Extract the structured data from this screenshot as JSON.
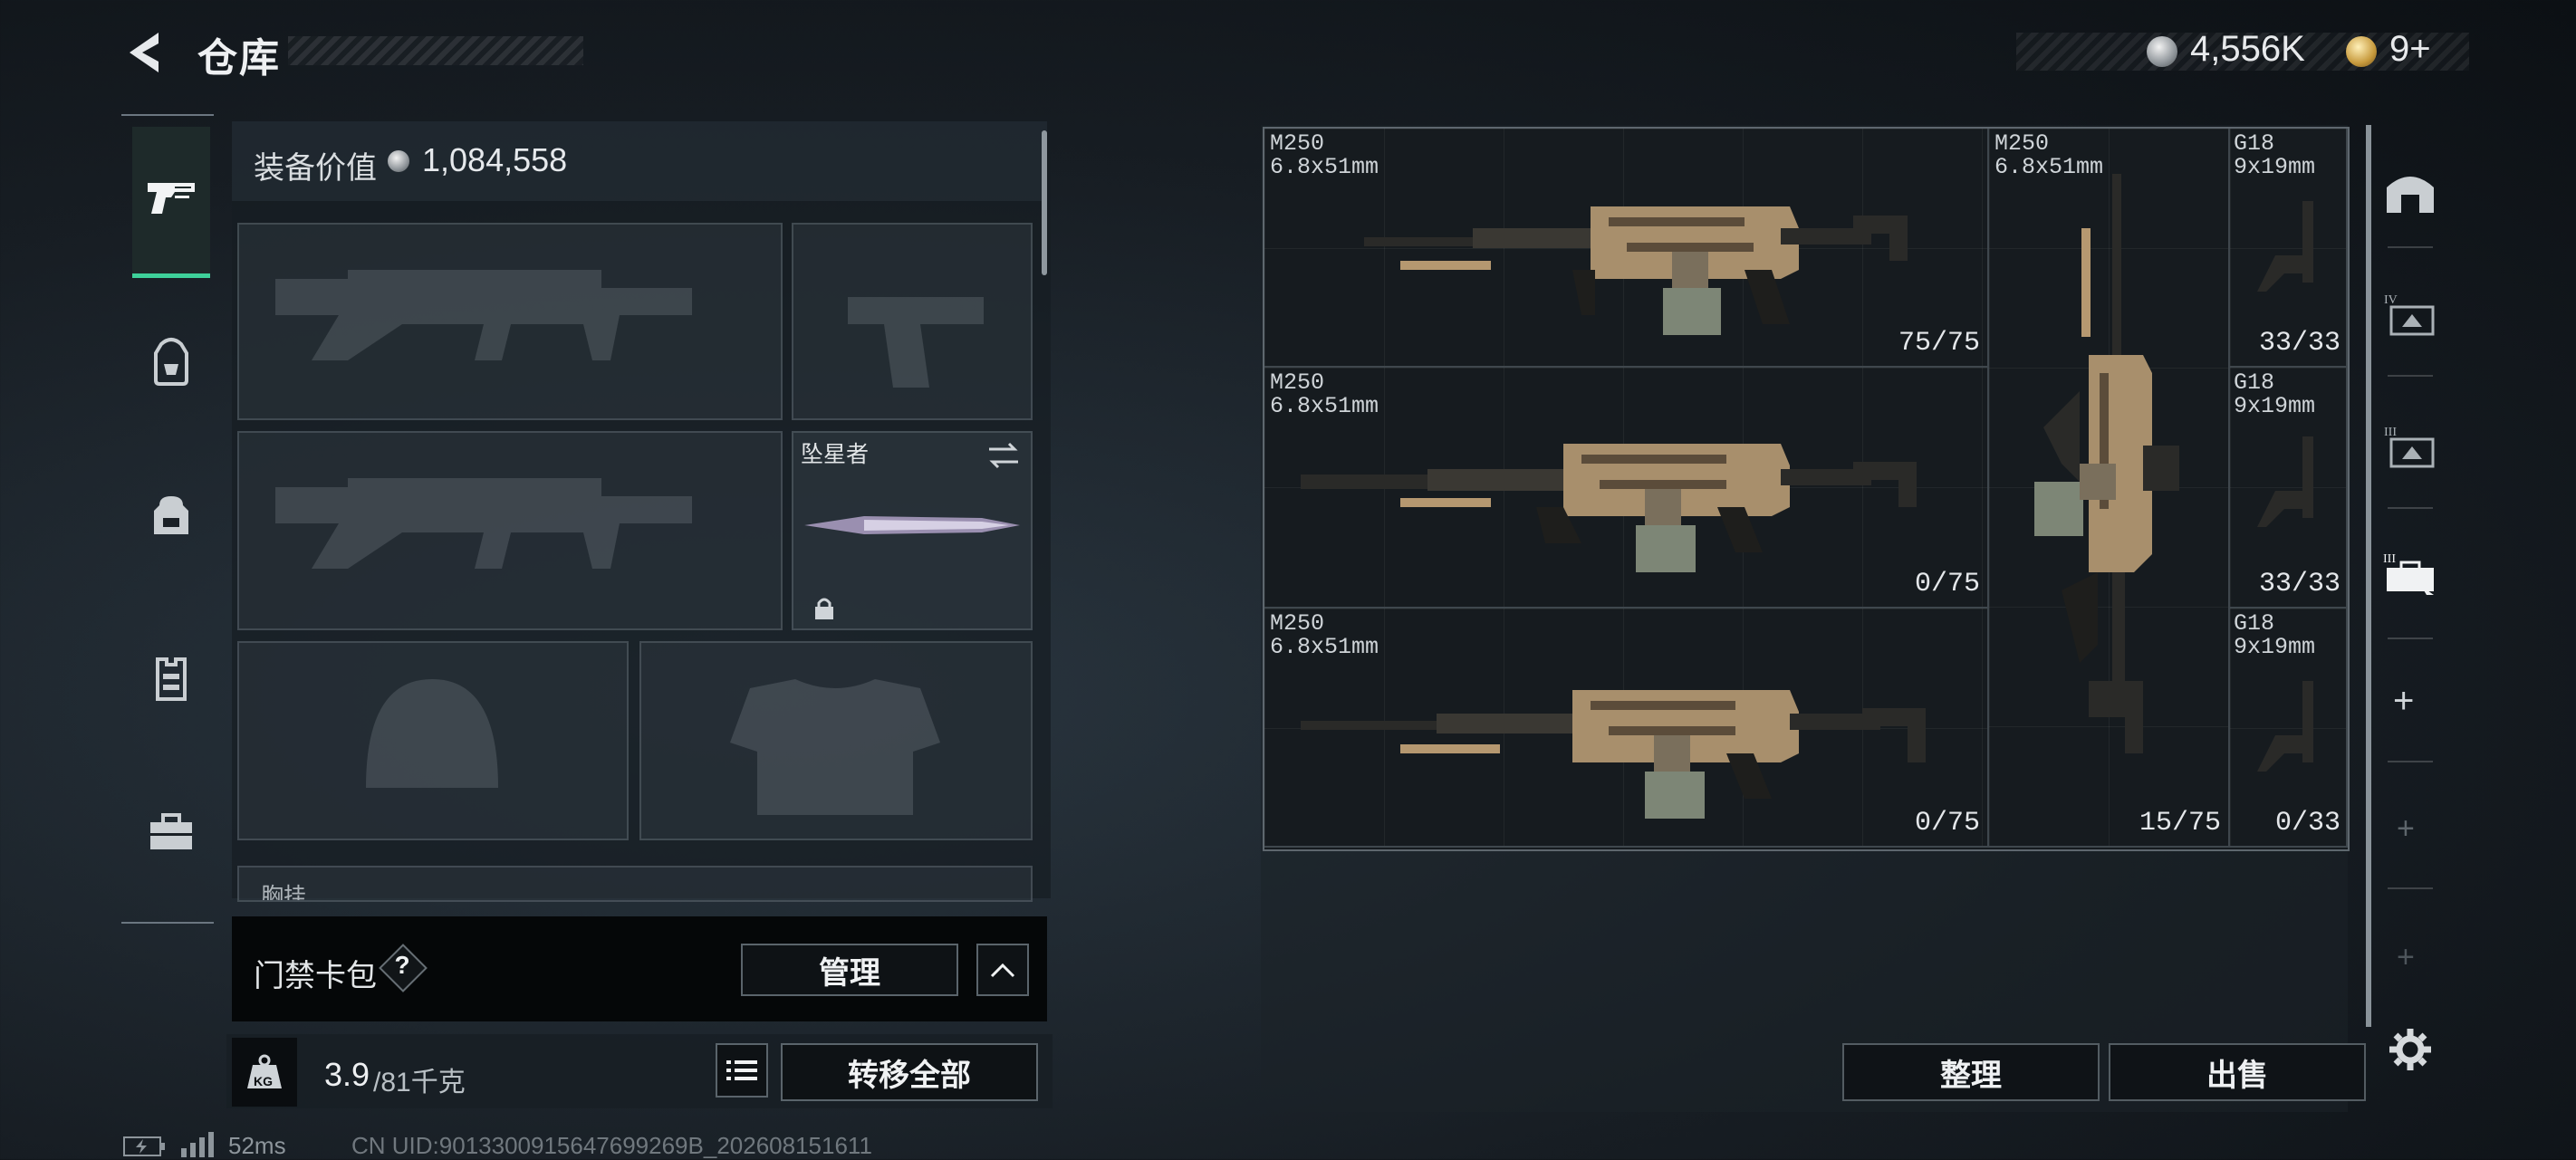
{
  "header": {
    "title": "仓库",
    "currency_silver": "4,556K",
    "currency_gold": "9+"
  },
  "left_rail": {
    "items": [
      {
        "icon": "pistol-icon",
        "active": true
      },
      {
        "icon": "backpack-icon"
      },
      {
        "icon": "pouch-icon"
      },
      {
        "icon": "vest-icon"
      },
      {
        "icon": "toolbox-icon"
      }
    ]
  },
  "stash": {
    "equip_label": "装备价值",
    "equip_value": "1,084,558",
    "melee_name": "坠星者",
    "chest_label": "胸挂",
    "access_label": "门禁卡包",
    "access_help": "?",
    "manage_label": "管理",
    "weight_icon": "KG",
    "weight_current": "3.9",
    "weight_max": "/81千克",
    "transfer_all_label": "转移全部"
  },
  "inventory": {
    "items": [
      {
        "name": "M250",
        "caliber": "6.8x51mm",
        "ammo": "75/75"
      },
      {
        "name": "M250",
        "caliber": "6.8x51mm",
        "ammo": "15/75"
      },
      {
        "name": "G18",
        "caliber": "9x19mm",
        "ammo": "33/33"
      },
      {
        "name": "M250",
        "caliber": "6.8x51mm",
        "ammo": "0/75"
      },
      {
        "name": "G18",
        "caliber": "9x19mm",
        "ammo": "33/33"
      },
      {
        "name": "M250",
        "caliber": "6.8x51mm",
        "ammo": "0/75"
      },
      {
        "name": "G18",
        "caliber": "9x19mm",
        "ammo": "0/33"
      }
    ],
    "sort_label": "整理",
    "sell_label": "出售"
  },
  "right_rail": {
    "items": [
      "vault-icon",
      "container-iv-icon",
      "container-iii-icon",
      "case-iii-icon"
    ],
    "add_label": "+"
  },
  "status": {
    "ping": "52ms",
    "uid": "CN UID:9013300915647699269B_202608151611"
  }
}
